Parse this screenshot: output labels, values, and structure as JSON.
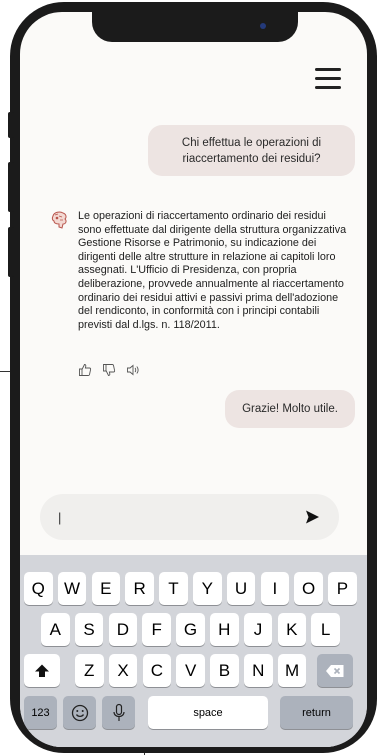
{
  "chat": {
    "user_question": "Chi effettua le operazioni di riaccertamento dei residui?",
    "bot_answer": "Le operazioni di riaccertamento ordinario dei residui sono effettuate dal dirigente della struttura organizzativa Gestione Risorse e Patrimonio, su indicazione dei dirigenti delle altre strutture in relazione ai capitoli loro assegnati. L'Ufficio di Presidenza, con propria deliberazione, provvede annualmente al riaccertamento ordinario dei residui attivi e passivi prima dell'adozione del rendiconto, in conformità con i principi contabili previsti dal d.lgs. n. 118/2011.",
    "user_reply": "Grazie! Molto utile."
  },
  "input": {
    "value": "|",
    "placeholder": ""
  },
  "keyboard": {
    "row1": [
      "Q",
      "W",
      "E",
      "R",
      "T",
      "Y",
      "U",
      "I",
      "O",
      "P"
    ],
    "row2": [
      "A",
      "S",
      "D",
      "F",
      "G",
      "H",
      "J",
      "K",
      "L"
    ],
    "row3": [
      "Z",
      "X",
      "C",
      "V",
      "B",
      "N",
      "M"
    ],
    "numbers_label": "123",
    "space_label": "space",
    "return_label": "return"
  },
  "icons": {
    "menu": "hamburger-menu-icon",
    "bot": "bot-avatar-icon",
    "like": "thumbs-up-icon",
    "dislike": "thumbs-down-icon",
    "speaker": "speaker-icon",
    "send": "send-icon",
    "shift": "shift-icon",
    "delete": "backspace-icon",
    "emoji": "emoji-icon",
    "mic": "microphone-icon"
  },
  "colors": {
    "bubble": "#ede4e2",
    "screen": "#fbfaf8",
    "keyboard": "#d3d5da",
    "accent_avatar": "#b8544c"
  }
}
